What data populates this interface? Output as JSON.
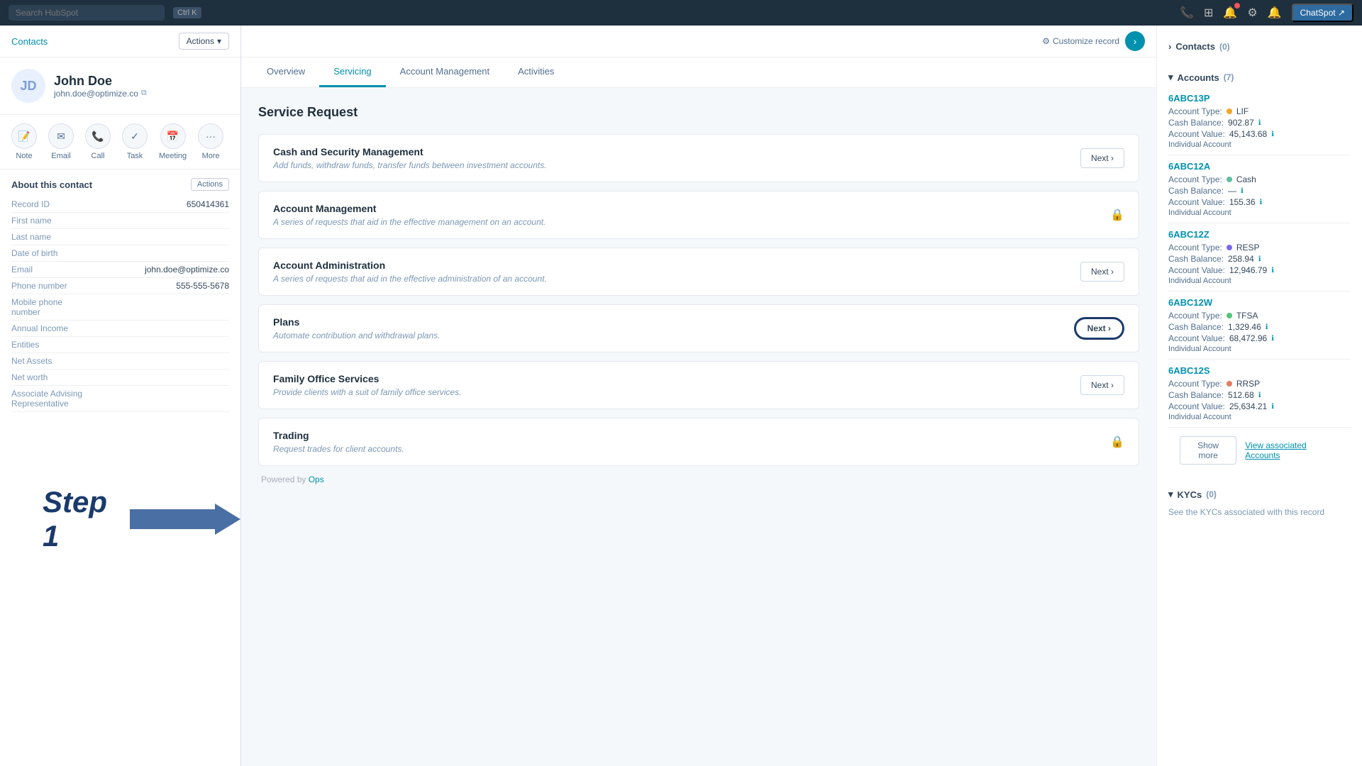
{
  "topbar": {
    "search_placeholder": "Search HubSpot",
    "shortcut": "Ctrl K",
    "chatspot_label": "ChatSpot ↗"
  },
  "sidebar": {
    "contacts_label": "Contacts",
    "actions_label": "Actions",
    "contact": {
      "name": "John Doe",
      "email": "john.doe@optimize.co",
      "avatar_initials": "JD"
    },
    "action_items": [
      {
        "label": "Note",
        "icon": "📝"
      },
      {
        "label": "Email",
        "icon": "✉"
      },
      {
        "label": "Call",
        "icon": "📞"
      },
      {
        "label": "Task",
        "icon": "✓"
      },
      {
        "label": "Meeting",
        "icon": "📅"
      },
      {
        "label": "More",
        "icon": "···"
      }
    ],
    "about_title": "About this contact",
    "about_actions": "Actions",
    "fields": [
      {
        "label": "Record ID",
        "value": "650414361"
      },
      {
        "label": "First name",
        "value": ""
      },
      {
        "label": "Last name",
        "value": ""
      },
      {
        "label": "Date of birth",
        "value": ""
      },
      {
        "label": "Email",
        "value": "john.doe@optimize.co"
      },
      {
        "label": "Phone number",
        "value": "555-555-5678"
      },
      {
        "label": "Mobile phone number",
        "value": ""
      },
      {
        "label": "Annual Income",
        "value": ""
      },
      {
        "label": "Entities",
        "value": ""
      },
      {
        "label": "Net Assets",
        "value": ""
      },
      {
        "label": "Net worth",
        "value": ""
      },
      {
        "label": "Associate Advising Representative",
        "value": ""
      }
    ]
  },
  "step1": {
    "label": "Step 1"
  },
  "center": {
    "customize_label": "Customize record",
    "tabs": [
      {
        "label": "Overview",
        "active": false
      },
      {
        "label": "Servicing",
        "active": true
      },
      {
        "label": "Account Management",
        "active": false
      },
      {
        "label": "Activities",
        "active": false
      }
    ],
    "section_title": "Service Request",
    "services": [
      {
        "id": "cash-security",
        "title": "Cash and Security Management",
        "description": "Add funds, withdraw funds, transfer funds between investment accounts.",
        "locked": false,
        "next_label": "Next ›"
      },
      {
        "id": "account-management",
        "title": "Account Management",
        "description": "A series of requests that aid in the effective management on an account.",
        "locked": true,
        "next_label": "Next ›"
      },
      {
        "id": "account-administration",
        "title": "Account Administration",
        "description": "A series of requests that aid in the effective administration of an account.",
        "locked": false,
        "next_label": "Next ›"
      },
      {
        "id": "plans",
        "title": "Plans",
        "description": "Automate contribution and withdrawal plans.",
        "locked": false,
        "next_label": "Next ›",
        "highlighted": true
      },
      {
        "id": "family-office",
        "title": "Family Office Services",
        "description": "Provide clients with a suit of family office services.",
        "locked": false,
        "next_label": "Next ›"
      },
      {
        "id": "trading",
        "title": "Trading",
        "description": "Request trades for client accounts.",
        "locked": true,
        "next_label": "Next ›"
      }
    ],
    "powered_by": "Powered by",
    "powered_link": "Ops"
  },
  "right_sidebar": {
    "contacts_section": {
      "label": "Contacts",
      "count": "(0)"
    },
    "accounts_section": {
      "label": "Accounts",
      "count": "(7)",
      "accounts": [
        {
          "id": "6ABC13P",
          "type_label": "Account Type:",
          "type_value": "LIF",
          "dot_class": "dot-lif",
          "cash_label": "Cash Balance:",
          "cash_value": "902.87",
          "value_label": "Account Value:",
          "account_value": "45,143.68",
          "sub_label": "Individual Account"
        },
        {
          "id": "6ABC12A",
          "type_label": "Account Type:",
          "type_value": "Cash",
          "dot_class": "dot-cash",
          "cash_label": "Cash Balance:",
          "cash_value": "—",
          "value_label": "Account Value:",
          "account_value": "155.36",
          "sub_label": "Individual Account"
        },
        {
          "id": "6ABC12Z",
          "type_label": "Account Type:",
          "type_value": "RESP",
          "dot_class": "dot-resp",
          "cash_label": "Cash Balance:",
          "cash_value": "258.94",
          "value_label": "Account Value:",
          "account_value": "12,946.79",
          "sub_label": "Individual Account"
        },
        {
          "id": "6ABC12W",
          "type_label": "Account Type:",
          "type_value": "TFSA",
          "dot_class": "dot-tfsa",
          "cash_label": "Cash Balance:",
          "cash_value": "1,329.46",
          "value_label": "Account Value:",
          "account_value": "68,472.96",
          "sub_label": "Individual Account"
        },
        {
          "id": "6ABC12S",
          "type_label": "Account Type:",
          "type_value": "RRSP",
          "dot_class": "dot-rrsp",
          "cash_label": "Cash Balance:",
          "cash_value": "512.68",
          "value_label": "Account Value:",
          "account_value": "25,634.21",
          "sub_label": "Individual Account"
        }
      ],
      "show_more_label": "Show more",
      "view_accounts_label": "View associated Accounts"
    },
    "kycs_section": {
      "label": "KYCs",
      "count": "(0)"
    }
  }
}
